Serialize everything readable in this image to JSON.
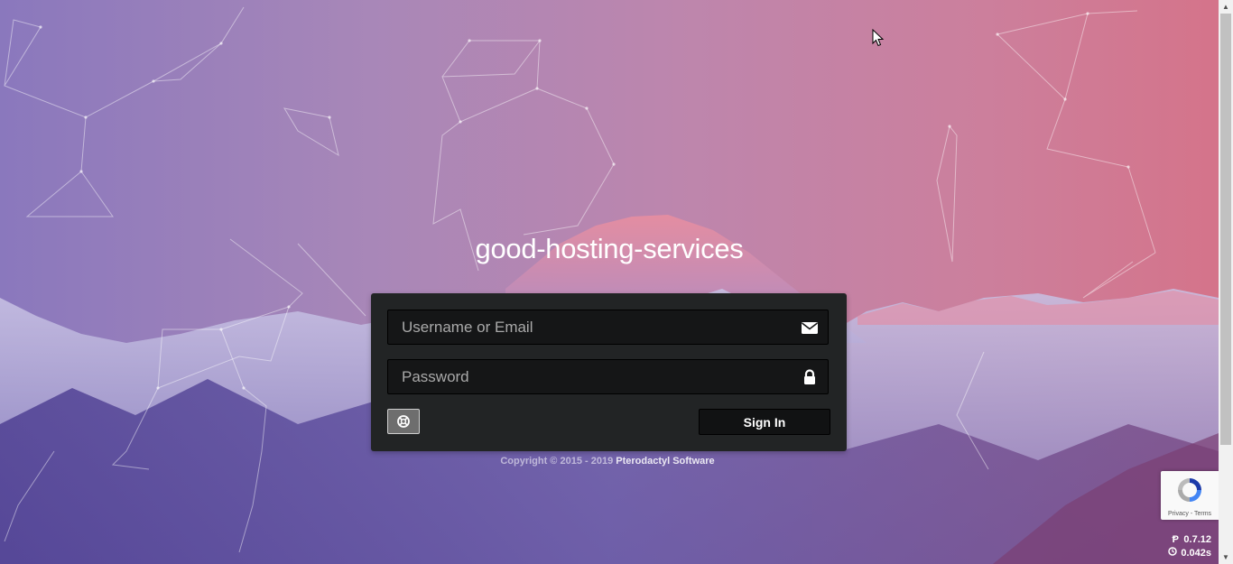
{
  "site": {
    "title": "good-hosting-services"
  },
  "login": {
    "username_placeholder": "Username or Email",
    "username_value": "",
    "password_placeholder": "Password",
    "password_value": "",
    "username_icon": "envelope-icon",
    "password_icon": "lock-icon",
    "support_icon": "life-ring-icon",
    "signin_label": "Sign In"
  },
  "footer": {
    "copyright_text": "Copyright © 2015 - 2019 ",
    "brand": "Pterodactyl Software"
  },
  "recaptcha": {
    "privacy": "Privacy",
    "separator": " - ",
    "terms": "Terms"
  },
  "version": {
    "number": "0.7.12",
    "render_time": "0.042s"
  },
  "colors": {
    "panel": "#222425",
    "field": "#151617",
    "button": "#111213"
  }
}
